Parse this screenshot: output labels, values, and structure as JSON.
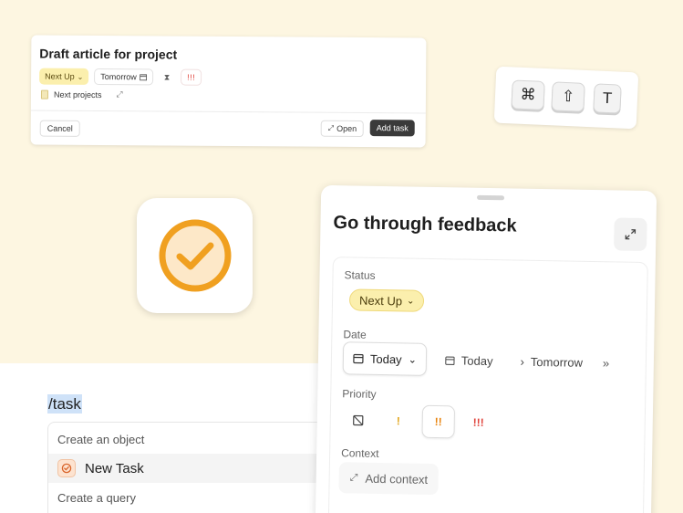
{
  "quick_add": {
    "title": "Draft article for project",
    "status": "Next Up",
    "date": "Tomorrow",
    "priority": "!!!",
    "project": "Next projects",
    "cancel_label": "Cancel",
    "open_label": "Open",
    "add_label": "Add task"
  },
  "shortcut_keys": [
    "⌘",
    "⇧",
    "T"
  ],
  "slash_menu": {
    "command_prefix": "/",
    "command": "task",
    "items": [
      "Create an object",
      "New Task",
      "Create a query"
    ]
  },
  "detail": {
    "title": "Go through feedback",
    "status_label": "Status",
    "status_value": "Next Up",
    "date_label": "Date",
    "date_value": "Today",
    "date_options": [
      "Today",
      "Tomorrow"
    ],
    "priority_label": "Priority",
    "priority_options": [
      "!",
      "!!",
      "!!!"
    ],
    "context_label": "Context",
    "context_button": "Add context"
  },
  "colors": {
    "background": "#fdf6e1",
    "status_yellow": "#fbefad",
    "accent_orange": "#f0a020",
    "priority_red": "#e0443c",
    "dark_button": "#3a3a3a"
  }
}
